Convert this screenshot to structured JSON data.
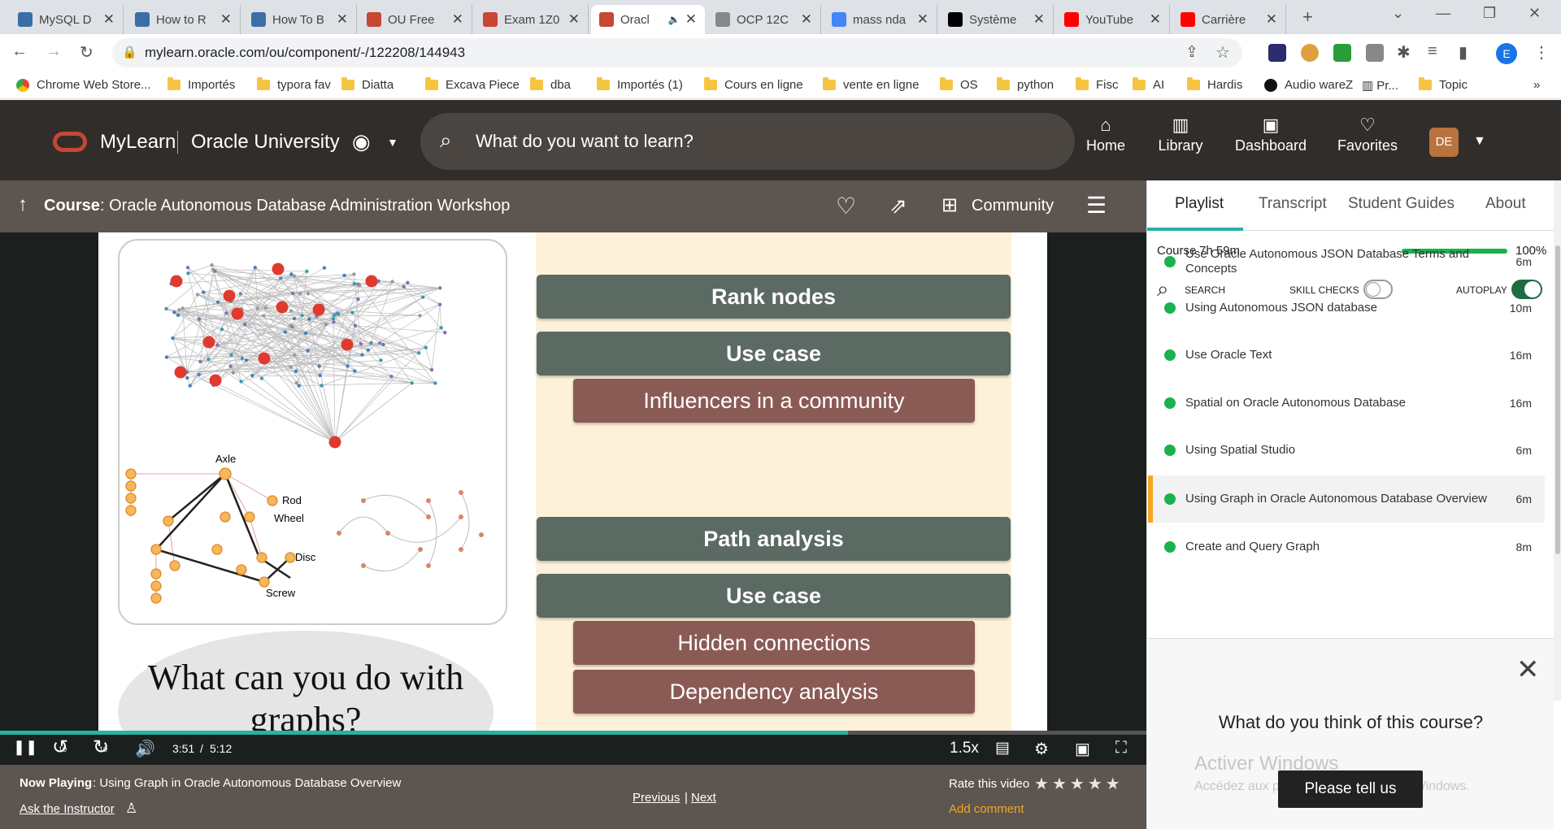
{
  "browser": {
    "tabs": [
      {
        "title": "MySQL D",
        "fav": "#3a6ea5"
      },
      {
        "title": "How to R",
        "fav": "#3a6ea5"
      },
      {
        "title": "How To B",
        "fav": "#3a6ea5"
      },
      {
        "title": "OU Free",
        "fav": "#c74634"
      },
      {
        "title": "Exam 1Z0",
        "fav": "#c74634"
      },
      {
        "title": "Oracl",
        "fav": "#c74634"
      },
      {
        "title": "OCP 12C",
        "fav": "#888888"
      },
      {
        "title": "mass nda",
        "fav": "#4285f4"
      },
      {
        "title": "Système",
        "fav": "#000000"
      },
      {
        "title": "YouTube",
        "fav": "#ff0000"
      },
      {
        "title": "Carrière",
        "fav": "#ff0000"
      }
    ],
    "url": "mylearn.oracle.com/ou/component/-/122208/144943",
    "profile_initial": "E",
    "bookmarks": [
      "Chrome Web Store...",
      "Importés",
      "typora fav",
      "Diatta",
      "Excava Piece",
      "dba",
      "Importés (1)",
      "Cours en ligne",
      "vente en ligne",
      "OS",
      "python",
      "Fisc",
      "AI",
      "Hardis",
      "Audio wareZ",
      "Pr...",
      "Topic"
    ]
  },
  "header": {
    "brand": "MyLearn",
    "university": "Oracle University",
    "search_placeholder": "What do you want to learn?",
    "nav": [
      "Home",
      "Library",
      "Dashboard",
      "Favorites"
    ],
    "avatar": "DE"
  },
  "course_bar": {
    "label": "Course",
    "title": ": Oracle Autonomous Database Administration Workshop",
    "community": "Community"
  },
  "slide": {
    "graph_labels": {
      "axle": "Axle",
      "rod": "Rod",
      "wheel": "Wheel",
      "disc": "Disc",
      "screw": "Screw"
    },
    "bottom_text": "What can you do with graphs?",
    "bars": [
      {
        "type": "header",
        "text": "Rank nodes"
      },
      {
        "type": "header",
        "text": "Use case"
      },
      {
        "type": "item",
        "text": "Influencers in a community"
      },
      {
        "type": "header",
        "text": "Path analysis"
      },
      {
        "type": "header",
        "text": "Use case"
      },
      {
        "type": "item",
        "text": "Hidden connections"
      },
      {
        "type": "item",
        "text": "Dependency analysis"
      }
    ]
  },
  "player": {
    "current_time": "3:51",
    "separator": "/",
    "duration": "5:12",
    "progress": 0.74,
    "speed": "1.5x",
    "skip_back": "10",
    "skip_fwd": "10"
  },
  "now_playing": {
    "label": "Now Playing",
    "title": ": Using Graph in Oracle Autonomous Database Overview",
    "ask": "Ask the Instructor",
    "previous": "Previous",
    "sep": "|",
    "next": "Next",
    "rate": "Rate this video",
    "add_comment": "Add comment"
  },
  "panel": {
    "tabs": [
      "Playlist",
      "Transcript",
      "Student Guides",
      "About"
    ],
    "course_label": "Course",
    "course_duration": "7h 59m",
    "course_progress": 1.0,
    "course_percent": "100%",
    "search": "SEARCH",
    "skill_checks": "SKILL CHECKS",
    "autoplay": "AUTOPLAY",
    "items": [
      {
        "title": "Use Oracle Autonomous JSON Database Terms and Concepts",
        "duration": "6m"
      },
      {
        "title": "Using Autonomous JSON database",
        "duration": "10m"
      },
      {
        "title": "Use Oracle Text",
        "duration": "16m"
      },
      {
        "title": "Spatial on Oracle Autonomous Database",
        "duration": "16m"
      },
      {
        "title": "Using Spatial Studio",
        "duration": "6m"
      },
      {
        "title": "Using Graph in Oracle Autonomous Database Overview",
        "duration": "6m",
        "current": true
      },
      {
        "title": "Create and Query Graph",
        "duration": "8m"
      }
    ],
    "feedback_question": "What do you think of this course?",
    "feedback_button": "Please tell us",
    "watermark_title": "Activer Windows",
    "watermark_sub": "Accédez aux paramètres pour activer Windows."
  },
  "colors": {
    "oracle_red": "#c74634",
    "green": "#1bb14e",
    "orange": "#f5a623",
    "teal": "#27b3a0"
  }
}
